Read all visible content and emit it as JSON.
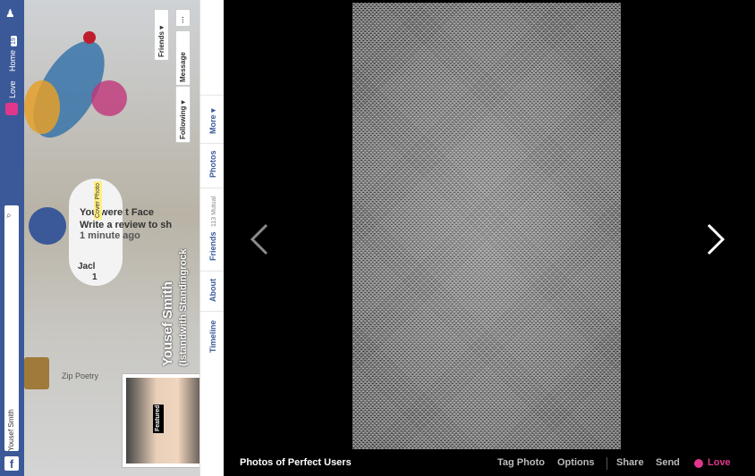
{
  "fb_bar": {
    "user_name": "Yousef Smith",
    "home_label": "Home",
    "home_count": "19",
    "love_label": "Love"
  },
  "profile": {
    "name": "Yousef Smith",
    "subtitle": "(Istandwith Standingrock",
    "cover_photo_label": "Cover Photo",
    "featured_label": "Featured",
    "friends_button": "Friends ▾",
    "message_button": "Message",
    "following_button": "Following ▾",
    "more_menu": "···"
  },
  "tabs": {
    "timeline": "Timeline",
    "about": "About",
    "friends": "Friends",
    "friends_count": "113 Mutual",
    "photos": "Photos",
    "more": "More ▾"
  },
  "cover_texts": {
    "line1": "You were t Face",
    "line2": "Write a review to sh",
    "line3": "1 minute ago",
    "name_partial": "Jacl",
    "count": "1",
    "zip": "Zip Poetry"
  },
  "viewer": {
    "album_title": "Photos of Perfect Users",
    "actions": {
      "tag_photo": "Tag Photo",
      "options": "Options",
      "share": "Share",
      "send": "Send",
      "love": "Love"
    },
    "prev_icon": "chevron-left-icon",
    "next_icon": "chevron-right-icon"
  },
  "colors": {
    "facebook_blue": "#3b5998",
    "love_pink": "#e0368c"
  }
}
